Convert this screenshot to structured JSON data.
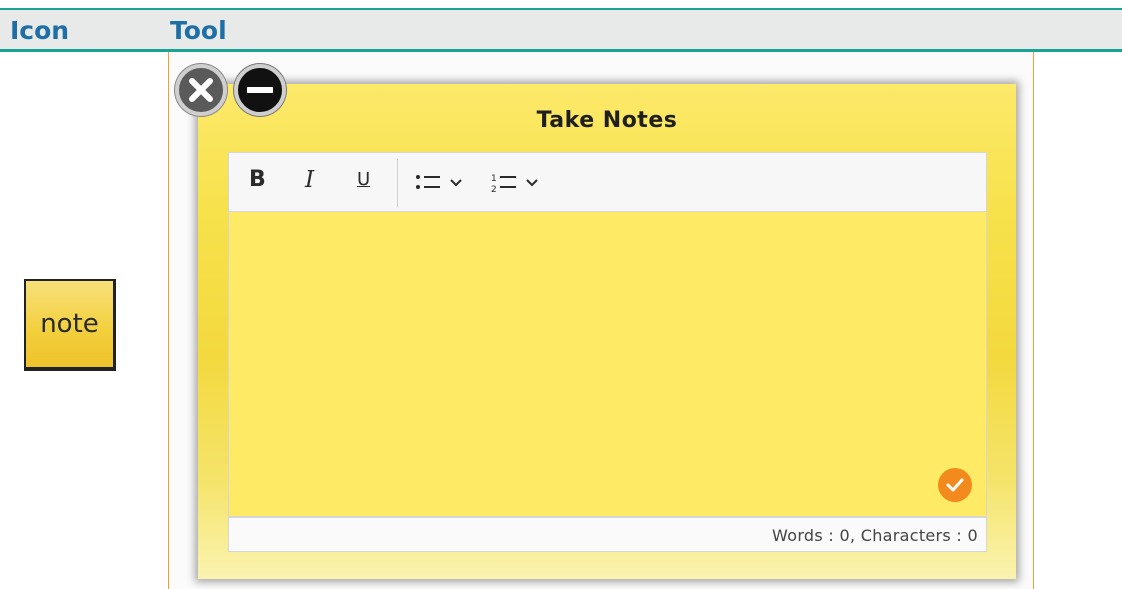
{
  "table": {
    "headers": [
      "Icon",
      "Tool"
    ]
  },
  "icon_cell": {
    "label": "note",
    "icon": "note-icon"
  },
  "note_window": {
    "title": "Take Notes",
    "controls": {
      "close_icon": "close-icon",
      "minimize_icon": "minimize-icon"
    },
    "toolbar": {
      "bold": "B",
      "italic": "I",
      "underline": "U",
      "bulleted_list_icon": "bulleted-list-icon",
      "numbered_list_icon": "numbered-list-icon"
    },
    "editor": {
      "value": "",
      "submit_icon": "check-icon"
    },
    "status": "Words : 0, Characters : 0"
  },
  "colors": {
    "header_border": "#1aa394",
    "header_text": "#1f6fa6",
    "note_yellow": "#ffea66",
    "check_orange": "#f28a1e"
  }
}
